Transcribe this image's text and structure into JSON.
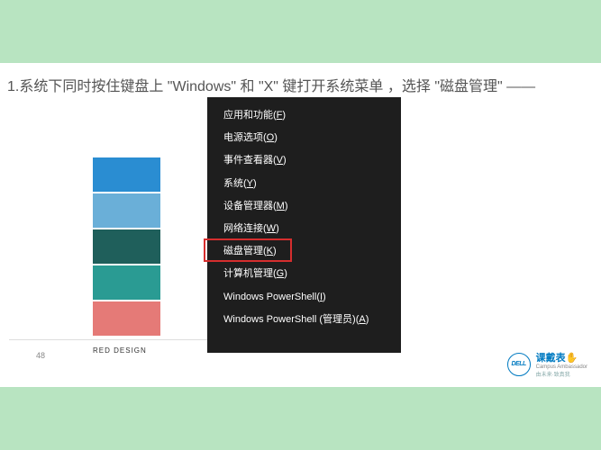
{
  "slide": {
    "title": "1.系统下同时按住键盘上 \"Windows\" 和 \"X\" 键打开系统菜单 ，选择 \"磁盘管理\" ——",
    "page_number": "48",
    "red_design_label": "RED DESIGN"
  },
  "swatches": [
    {
      "name": "blue",
      "color": "#2a8dd2"
    },
    {
      "name": "light-blue",
      "color": "#6aafd8"
    },
    {
      "name": "dark-teal",
      "color": "#1f5f5b"
    },
    {
      "name": "teal",
      "color": "#2a9b93"
    },
    {
      "name": "coral",
      "color": "#e57a77"
    }
  ],
  "context_menu": {
    "items": [
      {
        "label": "应用和功能",
        "key": "F"
      },
      {
        "label": "电源选项",
        "key": "O"
      },
      {
        "label": "事件查看器",
        "key": "V"
      },
      {
        "label": "系统",
        "key": "Y"
      },
      {
        "label": "设备管理器",
        "key": "M"
      },
      {
        "label": "网络连接",
        "key": "W"
      },
      {
        "label": "磁盘管理",
        "key": "K",
        "highlighted": true
      },
      {
        "label": "计算机管理",
        "key": "G"
      },
      {
        "label": "Windows PowerShell",
        "key": "I"
      },
      {
        "label": "Windows PowerShell (管理员)",
        "key": "A"
      }
    ]
  },
  "logo": {
    "brand": "DELL",
    "main": "课戴表",
    "sub1": "Campus Ambassador",
    "sub2": "由未来·致真我"
  }
}
